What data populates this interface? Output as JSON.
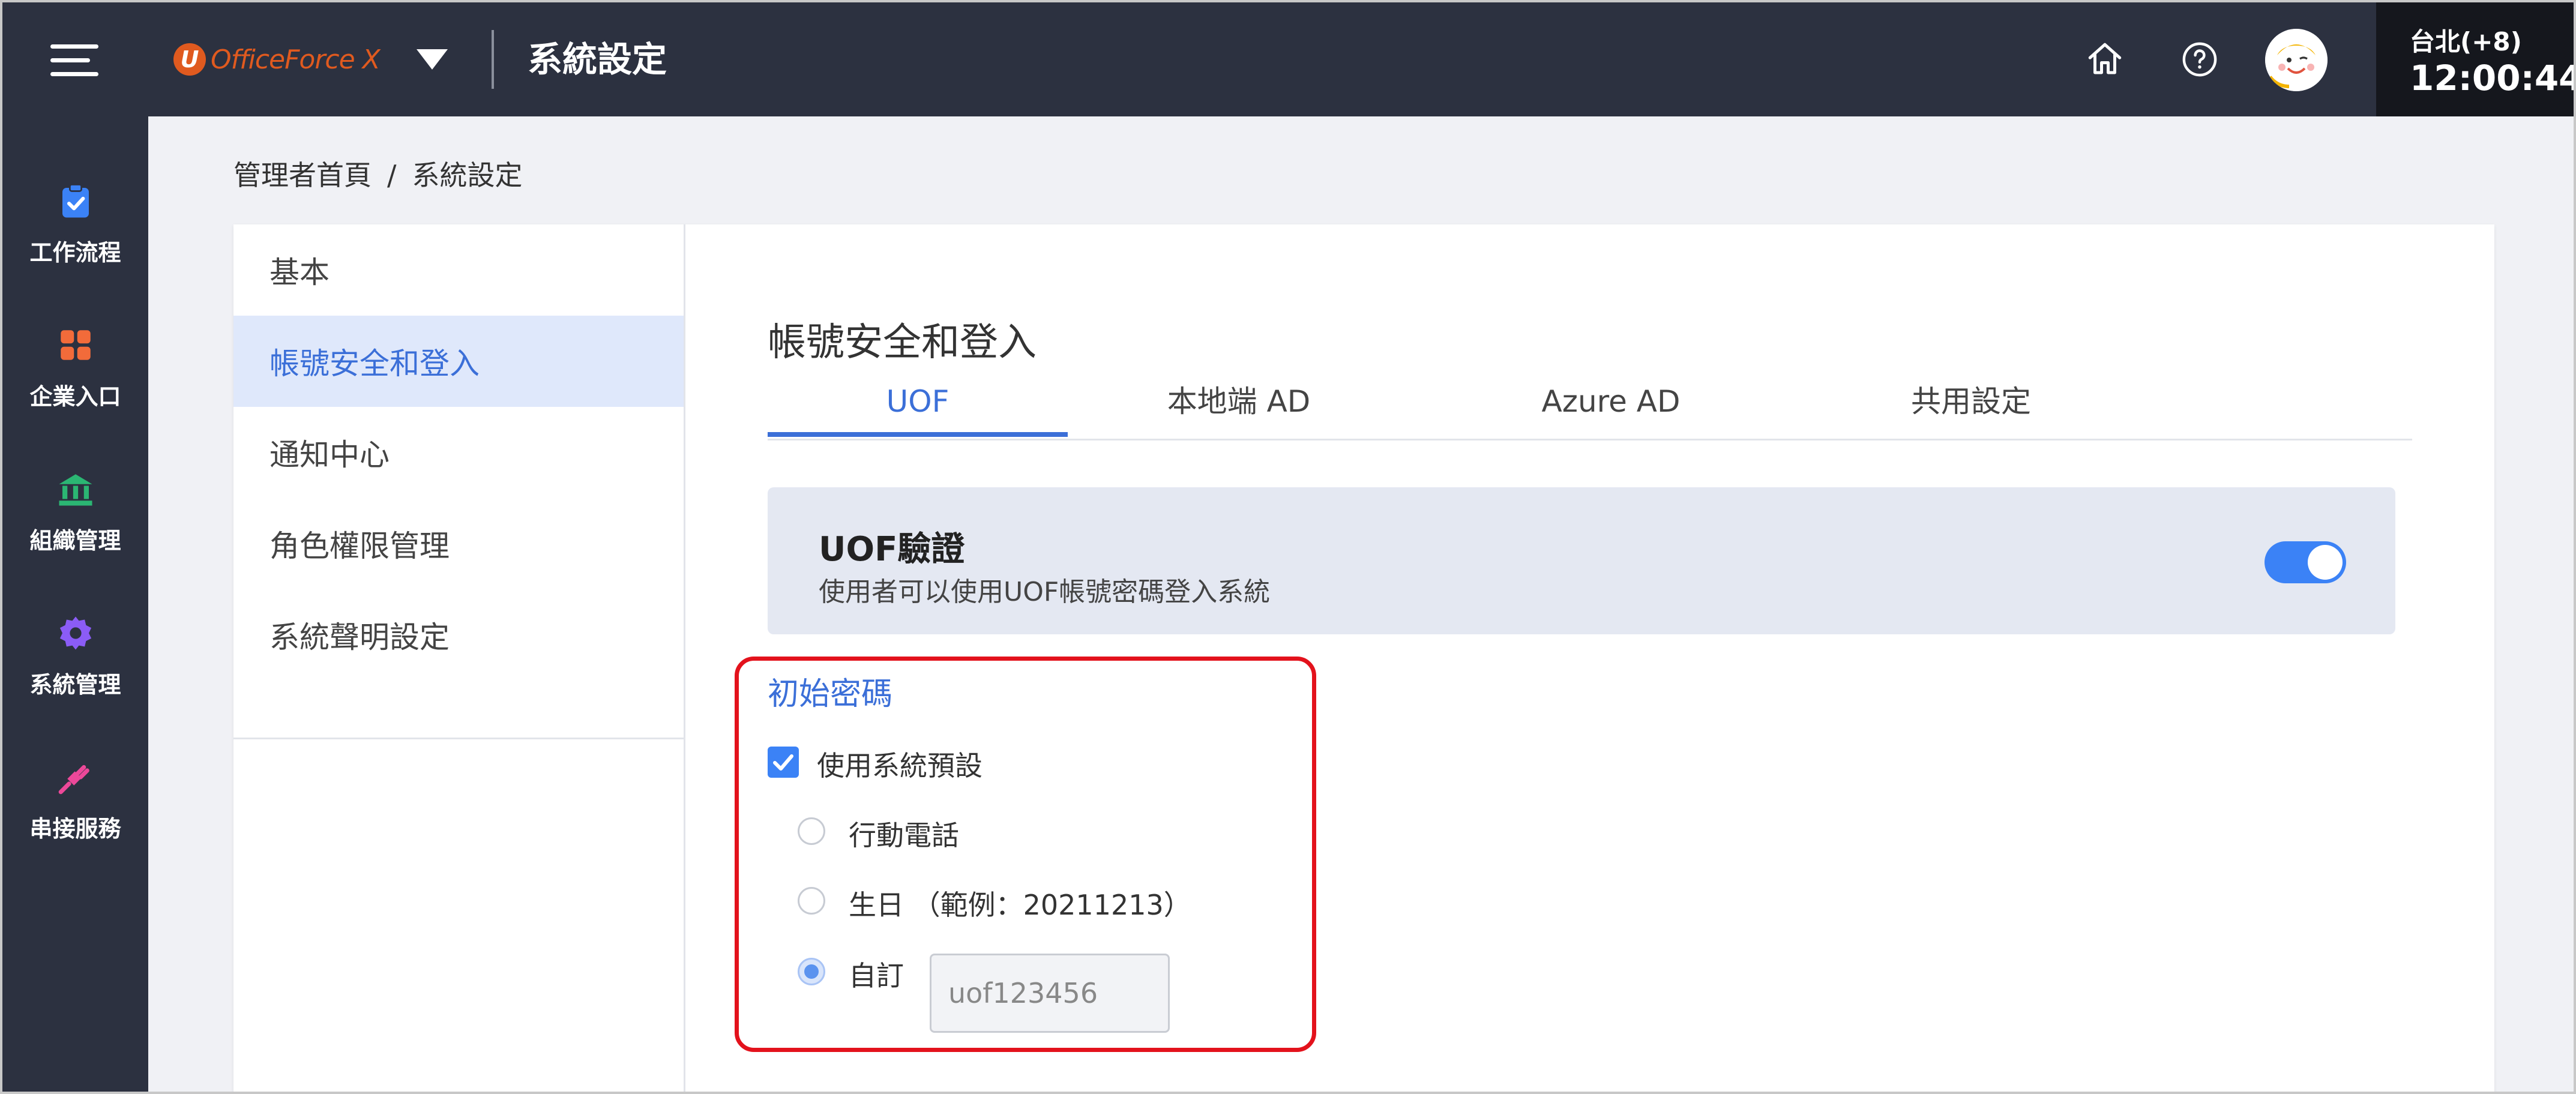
{
  "header": {
    "brand": "OfficeForce X",
    "app_title": "系統設定",
    "clock_timezone": "台北(+8)",
    "clock_time": "12:00:44"
  },
  "rail": {
    "items": [
      {
        "label": "工作流程",
        "icon": "clipboard-check-icon",
        "color": "#3b82f6"
      },
      {
        "label": "企業入口",
        "icon": "grid-icon",
        "color": "#f26b3a"
      },
      {
        "label": "組織管理",
        "icon": "bank-icon",
        "color": "#2bb673"
      },
      {
        "label": "系統管理",
        "icon": "gear-icon",
        "color": "#8b5cf6"
      },
      {
        "label": "串接服務",
        "icon": "plug-icon",
        "color": "#ec4899"
      }
    ]
  },
  "breadcrumb": {
    "home": "管理者首頁",
    "separator": "/",
    "current": "系統設定"
  },
  "settings_menu": {
    "items": [
      "基本",
      "帳號安全和登入",
      "通知中心",
      "角色權限管理",
      "系統聲明設定"
    ],
    "active_index": 1
  },
  "section": {
    "title": "帳號安全和登入",
    "tabs": [
      "UOF",
      "本地端 AD",
      "Azure AD",
      "共用設定"
    ],
    "active_tab": 0
  },
  "uof_auth": {
    "title": "UOF驗證",
    "description": "使用者可以使用UOF帳號密碼登入系統",
    "enabled": true
  },
  "initial_password": {
    "title": "初始密碼",
    "use_default_label": "使用系統預設",
    "use_default_checked": true,
    "options": [
      "行動電話",
      "生日",
      "自訂"
    ],
    "birthday_example": "（範例：20211213）",
    "selected_option": 2,
    "custom_value": "uof123456"
  },
  "colors": {
    "topbar": "#2c3140",
    "accent": "#3b6fd8",
    "highlight_border": "#e3121c"
  }
}
